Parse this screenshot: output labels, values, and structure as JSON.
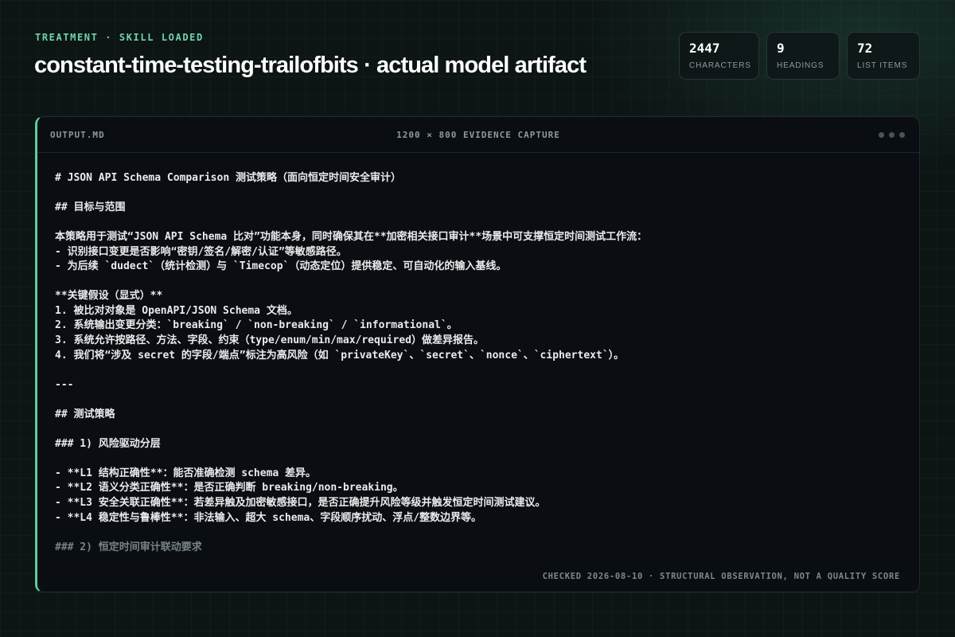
{
  "header": {
    "eyebrow": "TREATMENT · SKILL LOADED",
    "title": "constant-time-testing-trailofbits · actual model artifact"
  },
  "stats": [
    {
      "value": "2447",
      "label": "CHARACTERS"
    },
    {
      "value": "9",
      "label": "HEADINGS"
    },
    {
      "value": "72",
      "label": "LIST ITEMS"
    }
  ],
  "panel": {
    "filename": "OUTPUT.MD",
    "caption": "1200 × 800 EVIDENCE CAPTURE",
    "menu_icon": "more-dots-icon",
    "footer": "CHECKED 2026-08-10 · STRUCTURAL OBSERVATION, NOT A QUALITY SCORE",
    "lines": [
      "# JSON API Schema Comparison 测试策略（面向恒定时间安全审计）",
      "",
      "## 目标与范围",
      "",
      "本策略用于测试“JSON API Schema 比对”功能本身，同时确保其在**加密相关接口审计**场景中可支撑恒定时间测试工作流：",
      "- 识别接口变更是否影响“密钥/签名/解密/认证”等敏感路径。",
      "- 为后续 `dudect`（统计检测）与 `Timecop`（动态定位）提供稳定、可自动化的输入基线。",
      "",
      "**关键假设（显式）**",
      "1. 被比对对象是 OpenAPI/JSON Schema 文档。",
      "2. 系统输出变更分类：`breaking` / `non-breaking` / `informational`。",
      "3. 系统允许按路径、方法、字段、约束（type/enum/min/max/required）做差异报告。",
      "4. 我们将“涉及 secret 的字段/端点”标注为高风险（如 `privateKey`、`secret`、`nonce`、`ciphertext`）。",
      "",
      "---",
      "",
      "## 测试策略",
      "",
      "### 1) 风险驱动分层",
      "",
      "- **L1 结构正确性**：能否准确检测 schema 差异。",
      "- **L2 语义分类正确性**：是否正确判断 breaking/non-breaking。",
      "- **L3 安全关联正确性**：若差异触及加密敏感接口，是否正确提升风险等级并触发恒定时间测试建议。",
      "- **L4 稳定性与鲁棒性**：非法输入、超大 schema、字段顺序扰动、浮点/整数边界等。",
      "",
      "### 2) 恒定时间审计联动要求"
    ]
  }
}
